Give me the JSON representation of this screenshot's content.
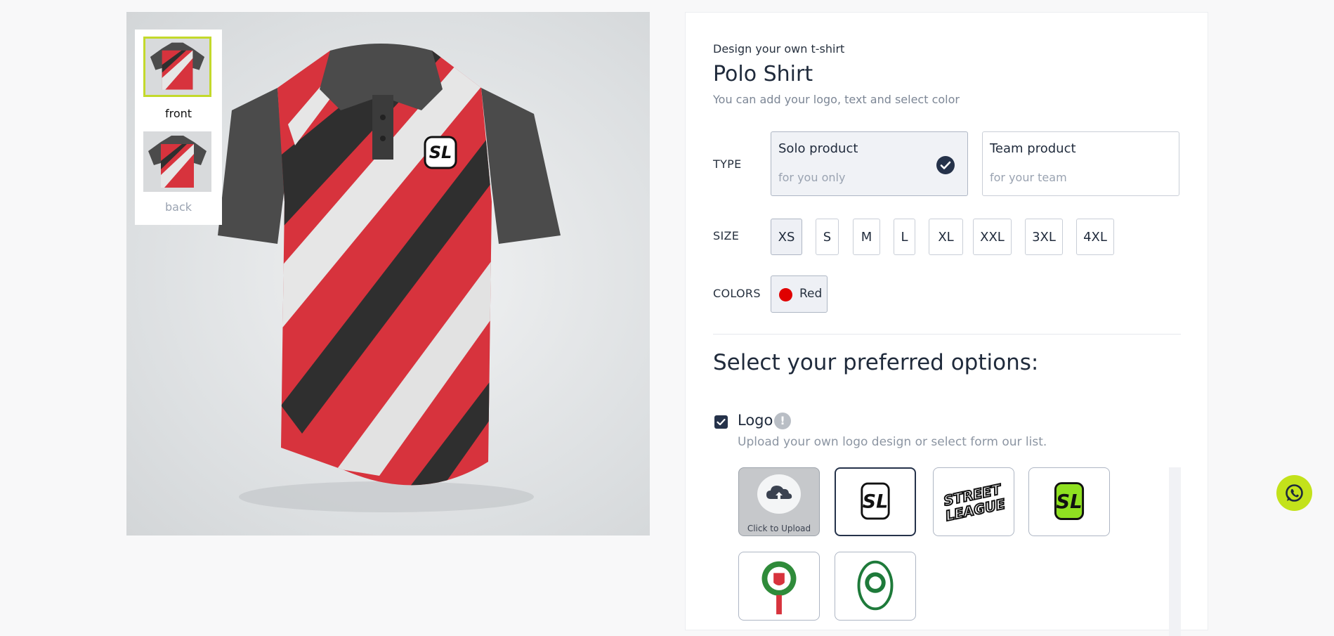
{
  "product_preview": {
    "thumbnails": [
      {
        "label": "front",
        "selected": true
      },
      {
        "label": "back",
        "selected": false
      }
    ],
    "shirt_colors": {
      "base": "#d7333d",
      "sleeve": "#4a4a4a",
      "stripe": "#e4e4e4",
      "dark_stripe": "#2e2e2e"
    }
  },
  "details": {
    "eyebrow": "Design your own t-shirt",
    "title": "Polo Shirt",
    "subtitle": "You can add your logo, text and select color"
  },
  "type": {
    "label": "TYPE",
    "options": [
      {
        "name": "Solo product",
        "desc": "for you only",
        "selected": true
      },
      {
        "name": "Team product",
        "desc": "for your team",
        "selected": false
      }
    ]
  },
  "size": {
    "label": "SIZE",
    "options": [
      "XS",
      "S",
      "M",
      "L",
      "XL",
      "XXL",
      "3XL",
      "4XL"
    ],
    "selected": "XS"
  },
  "colors": {
    "label": "COLORS",
    "options": [
      {
        "name": "Red",
        "hex": "#e00000",
        "selected": true
      }
    ]
  },
  "options": {
    "title": "Select your preferred options:",
    "logo": {
      "label": "Logo",
      "checked": true,
      "info_icon": "!",
      "hint": "Upload your own logo design or select form our list.",
      "upload_label": "Click to Upload",
      "upload_icon": "cloud-upload-icon",
      "tiles": [
        "sl-black-logo",
        "street-league-logo",
        "sl-green-logo",
        "red-crest-logo",
        "green-crest-logo"
      ],
      "selected_tile": "sl-black-logo"
    }
  },
  "floating": {
    "whatsapp_icon": "whatsapp-icon",
    "accent": "#c3e21b"
  }
}
